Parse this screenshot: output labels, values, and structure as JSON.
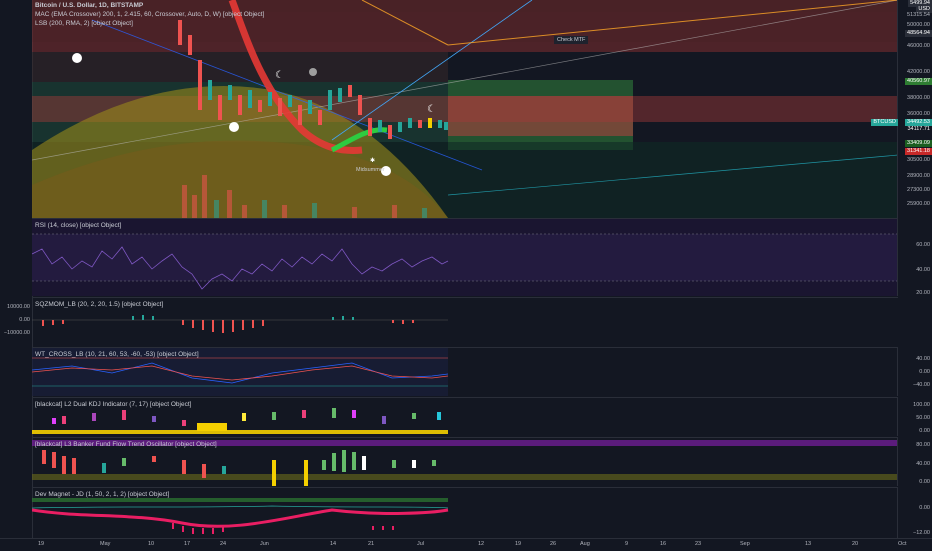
{
  "main": {
    "title": "Bitcoin / U.S. Dollar, 1D, BITSTAMP",
    "ind1": "MAC (EMA Crossover) 200, 1, 2.415, 60, Crossover, Auto, D, W) [object Object]",
    "ind2": "LSB (200, RMA, 2) [object Object]",
    "check_label": "Check MTF",
    "midsummer_label": "Midsummer",
    "symbol_badge": "BTCUSD",
    "price_ticks": [
      "51315.54",
      "50000.00",
      "48564.94",
      "46000.00",
      "42000.00",
      "40560.97",
      "38000.00",
      "36000.00",
      "34492.53",
      "34117.71",
      "33409.09",
      "31341.18",
      "30500.00",
      "28900.00",
      "27300.00",
      "25900.00"
    ],
    "top_badge": "5499.94",
    "usd_badge": "USD",
    "current_price": "34117.71"
  },
  "panes": {
    "rsi": {
      "label": "RSI (14, close) [object Object]",
      "ticks": [
        "60.00",
        "40.00",
        "20.00"
      ]
    },
    "sqz": {
      "label": "SQZMOM_LB (20, 2, 20, 1.5) [object Object]",
      "left_ticks": [
        "10000.00",
        "0.00",
        "−10000.00"
      ]
    },
    "wt": {
      "label": "WT_CROSS_LB (10, 21, 60, 53, -60, -53) [object Object]",
      "ticks": [
        "40.00",
        "0.00",
        "−40.00"
      ]
    },
    "kdj": {
      "label": "[blackcat] L2 Dual KDJ Indicator (7, 17) [object Object]",
      "ticks": [
        "100.00",
        "50.00",
        "0.00"
      ]
    },
    "banker": {
      "label": "[blackcat] L3 Banker Fund Flow Trend Oscillator [object Object]",
      "ticks": [
        "80.00",
        "40.00",
        "0.00"
      ]
    },
    "dev": {
      "label": "Dev Magnet - JD (1, 50, 2, 1, 2) [object Object]",
      "ticks": [
        "0.00",
        "−12.00"
      ]
    }
  },
  "xaxis": [
    "19",
    "May",
    "10",
    "17",
    "24",
    "Jun",
    "14",
    "21",
    "Jul",
    "12",
    "19",
    "26",
    "Aug",
    "9",
    "16",
    "23",
    "Sep",
    "13",
    "20",
    "Oct"
  ],
  "colors": {
    "bg": "#131722",
    "up": "#26a69a",
    "down": "#ef5350",
    "accent_blue": "#2962ff"
  }
}
